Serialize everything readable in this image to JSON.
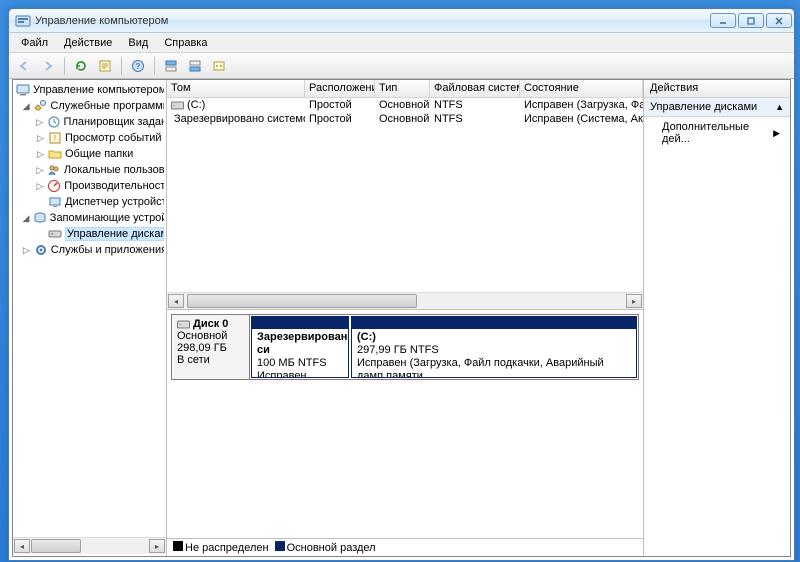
{
  "title": "Управление компьютером",
  "menu": {
    "file": "Файл",
    "action": "Действие",
    "view": "Вид",
    "help": "Справка"
  },
  "tree": {
    "root": "Управление компьютером (л",
    "sys_tools": "Служебные программы",
    "scheduler": "Планировщик заданий",
    "eventvwr": "Просмотр событий",
    "shared": "Общие папки",
    "users": "Локальные пользоват",
    "perf": "Производительность",
    "devmgr": "Диспетчер устройств",
    "storage": "Запоминающие устройст",
    "diskmgmt": "Управление дисками",
    "services": "Службы и приложения"
  },
  "vol_headers": {
    "tom": "Том",
    "layout": "Расположение",
    "type": "Тип",
    "fs": "Файловая система",
    "state": "Состояние"
  },
  "volumes": [
    {
      "name": "(C:)",
      "layout": "Простой",
      "type": "Основной",
      "fs": "NTFS",
      "state": "Исправен (Загрузка, Фай"
    },
    {
      "name": "Зарезервировано системой",
      "layout": "Простой",
      "type": "Основной",
      "fs": "NTFS",
      "state": "Исправен (Система, Акти"
    }
  ],
  "disk": {
    "label": "Диск 0",
    "type": "Основной",
    "size": "298,09 ГБ",
    "status": "В сети",
    "parts": [
      {
        "title": "Зарезервировано си",
        "sz": "100 МБ NTFS",
        "st": "Исправен (Система,",
        "w": 98
      },
      {
        "title": "(C:)",
        "sz": "297,99 ГБ NTFS",
        "st": "Исправен (Загрузка, Файл подкачки, Аварийный дамп памяти",
        "w": 0
      }
    ]
  },
  "legend": {
    "unalloc": "Не распределен",
    "primary": "Основной раздел"
  },
  "actions": {
    "header": "Действия",
    "section": "Управление дисками",
    "more": "Дополнительные дей..."
  }
}
